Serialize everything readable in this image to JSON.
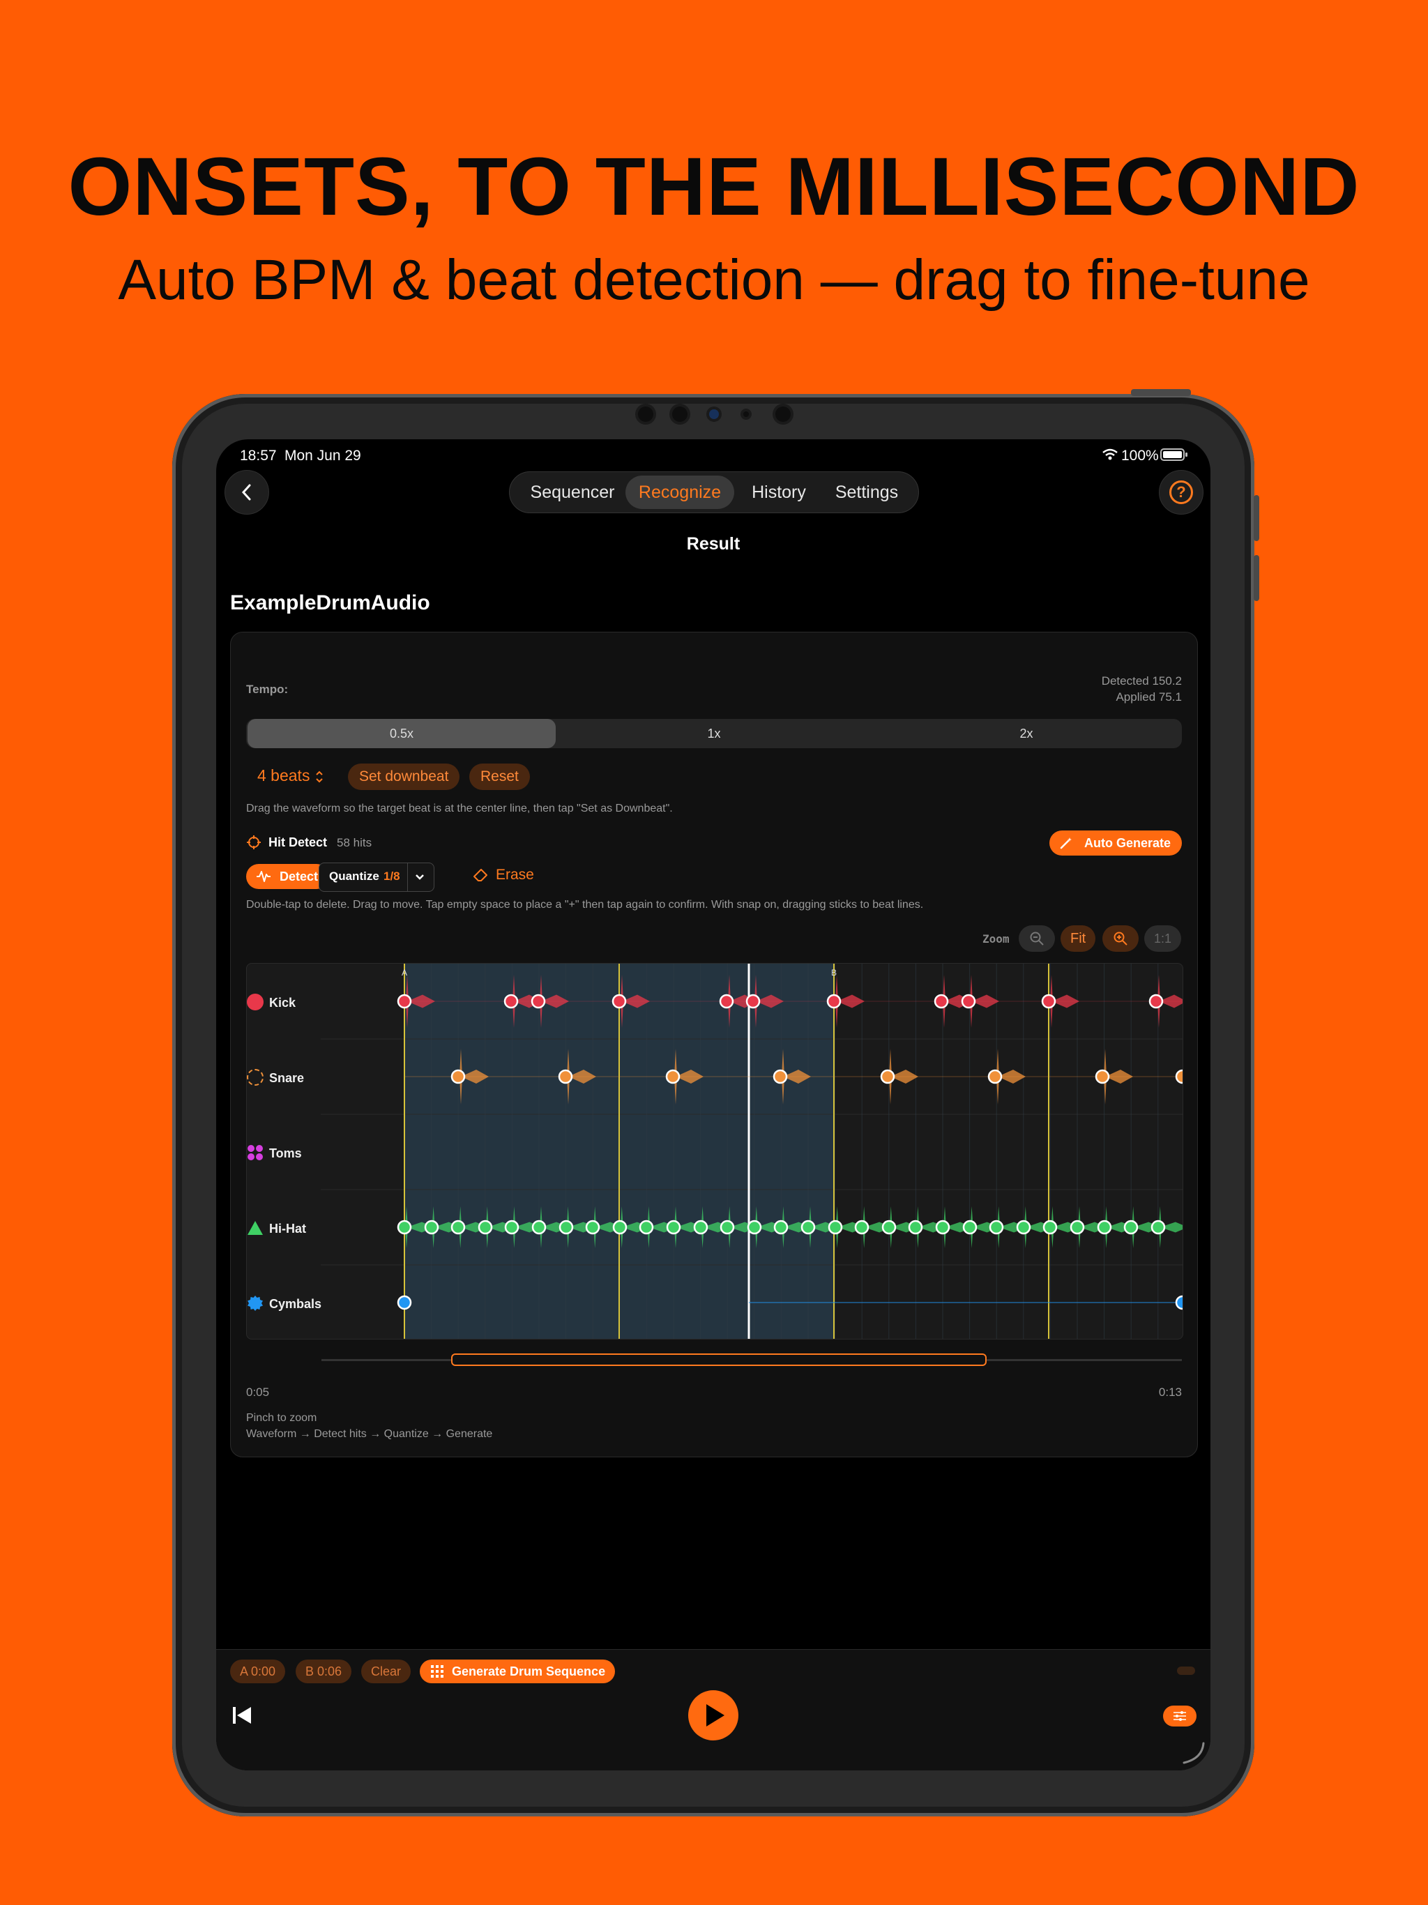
{
  "promo": {
    "headline": "ONSETS, TO THE MILLISECOND",
    "subhead": "Auto BPM & beat detection — drag to fine-tune"
  },
  "status_bar": {
    "time": "18:57",
    "date": "Mon Jun 29",
    "battery": "100%"
  },
  "nav": {
    "tabs": [
      {
        "label": "Sequencer"
      },
      {
        "label": "Recognize",
        "active": true
      },
      {
        "label": "History"
      },
      {
        "label": "Settings"
      }
    ],
    "page_title": "Result",
    "help_glyph": "?"
  },
  "file_name": "ExampleDrumAudio",
  "tempo": {
    "label": "Tempo:",
    "detected": "Detected 150.2",
    "applied": "Applied 75.1",
    "speed_options": [
      {
        "label": "0.5x",
        "selected": true
      },
      {
        "label": "1x"
      },
      {
        "label": "2x"
      }
    ]
  },
  "downbeat": {
    "beats_label": "4 beats",
    "set_label": "Set downbeat",
    "reset_label": "Reset",
    "hint": "Drag the waveform so the target beat is at the center line, then tap \"Set as Downbeat\"."
  },
  "hit_detect": {
    "title": "Hit Detect",
    "count": "58 hits",
    "auto_generate_label": "Auto Generate",
    "detect_label": "Detect",
    "quantize_label": "Quantize",
    "quantize_value": "1/8",
    "erase_label": "Erase",
    "hint": "Double-tap to delete. Drag to move. Tap empty space to place a \"+\" then tap again to confirm. With snap on, dragging sticks to beat lines."
  },
  "zoom": {
    "label": "Zoom",
    "fit_label": "Fit",
    "one_to_one_label": "1:1"
  },
  "timeline": {
    "markers": {
      "a": "A",
      "b": "B"
    },
    "start_time": "0:05",
    "end_time": "0:13",
    "footer_line1": "Pinch to zoom",
    "footer_line2": "Waveform → Detect hits → Quantize → Generate"
  },
  "lanes": [
    {
      "name": "Kick",
      "color": "#e8384a"
    },
    {
      "name": "Snare",
      "color": "#f0913a"
    },
    {
      "name": "Toms",
      "color": "#d63fe0"
    },
    {
      "name": "Hi-Hat",
      "color": "#3fd064"
    },
    {
      "name": "Cymbals",
      "color": "#2196f3"
    }
  ],
  "transport": {
    "a_chip": "A 0:00",
    "b_chip": "B 0:06",
    "clear_chip": "Clear",
    "generate_label": "Generate Drum Sequence"
  },
  "colors": {
    "accent": "#ff6a10",
    "background": "#ff5c04"
  }
}
